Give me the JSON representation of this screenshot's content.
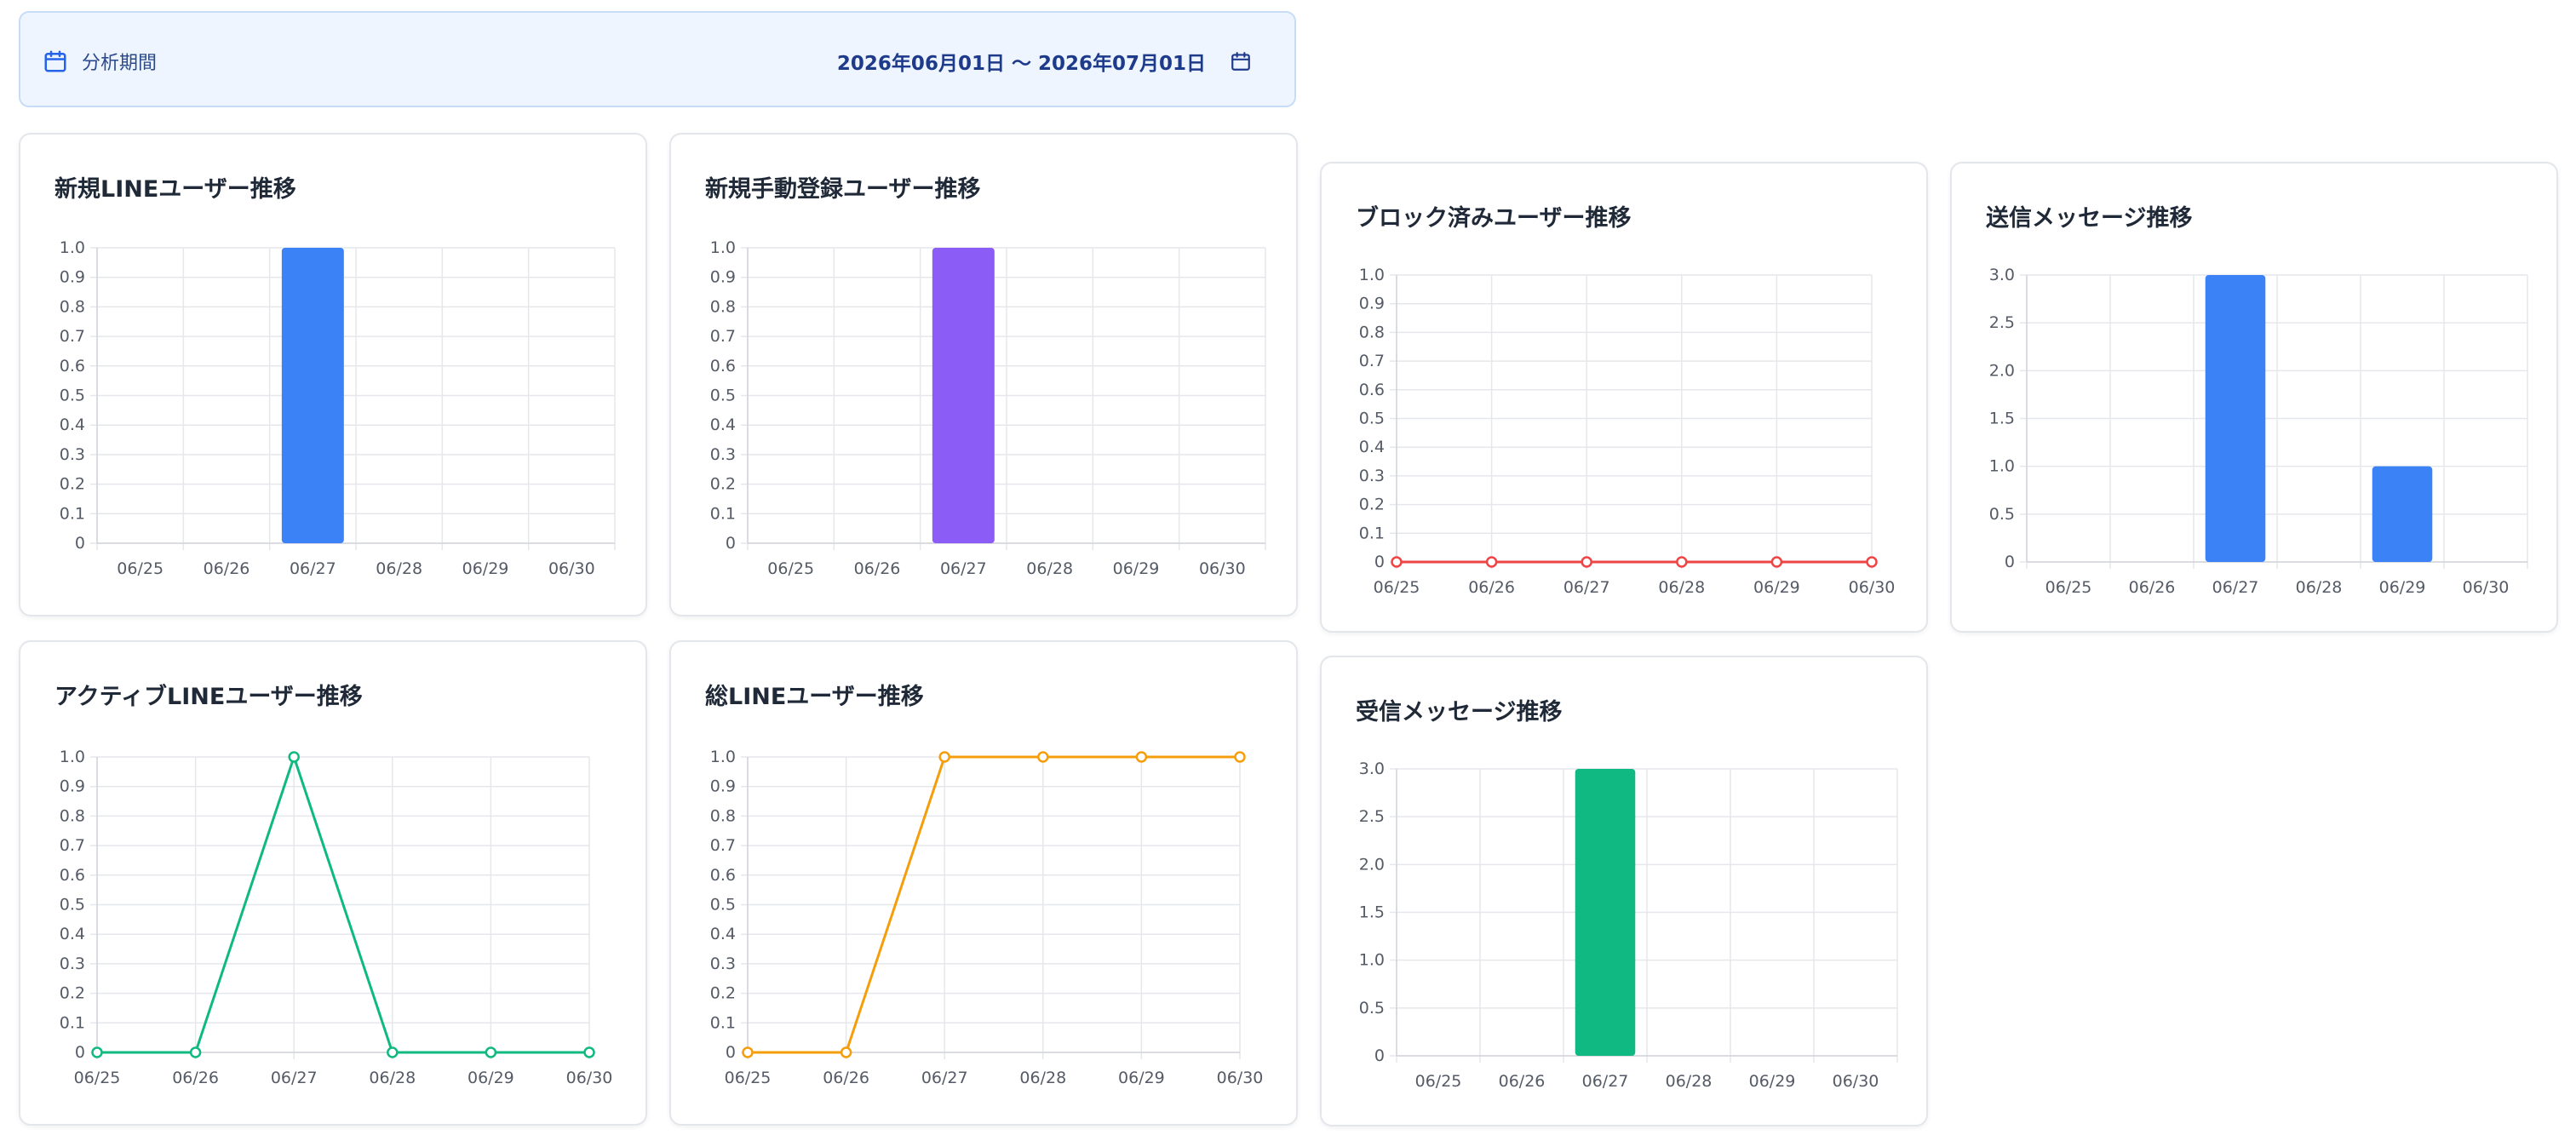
{
  "period": {
    "label": "分析期間",
    "range": "2026年06月01日 〜 2026年07月01日",
    "icon_left": "calendar-icon",
    "icon_right": "calendar-icon"
  },
  "colors": {
    "blue": "#3b82f6",
    "purple": "#8b5cf6",
    "red": "#ef4444",
    "green": "#10b981",
    "orange": "#f59e0b"
  },
  "cards": [
    {
      "title": "新規LINEユーザー推移"
    },
    {
      "title": "新規手動登録ユーザー推移"
    },
    {
      "title": "ブロック済みユーザー推移"
    },
    {
      "title": "送信メッセージ推移"
    },
    {
      "title": "アクティブLINEユーザー推移"
    },
    {
      "title": "総LINEユーザー推移"
    },
    {
      "title": "受信メッセージ推移"
    }
  ],
  "chart_data": [
    {
      "type": "bar",
      "title": "新規LINEユーザー推移",
      "categories": [
        "06/25",
        "06/26",
        "06/27",
        "06/28",
        "06/29",
        "06/30"
      ],
      "values": [
        0,
        0,
        1,
        0,
        0,
        0
      ],
      "ylim": [
        0,
        1.0
      ],
      "yticks": [
        "0",
        "0.1",
        "0.2",
        "0.3",
        "0.4",
        "0.5",
        "0.6",
        "0.7",
        "0.8",
        "0.9",
        "1.0"
      ],
      "color": "#3b82f6",
      "grid": true,
      "legend": false
    },
    {
      "type": "bar",
      "title": "新規手動登録ユーザー推移",
      "categories": [
        "06/25",
        "06/26",
        "06/27",
        "06/28",
        "06/29",
        "06/30"
      ],
      "values": [
        0,
        0,
        1,
        0,
        0,
        0
      ],
      "ylim": [
        0,
        1.0
      ],
      "yticks": [
        "0",
        "0.1",
        "0.2",
        "0.3",
        "0.4",
        "0.5",
        "0.6",
        "0.7",
        "0.8",
        "0.9",
        "1.0"
      ],
      "color": "#8b5cf6",
      "grid": true,
      "legend": false
    },
    {
      "type": "line",
      "title": "ブロック済みユーザー推移",
      "categories": [
        "06/25",
        "06/26",
        "06/27",
        "06/28",
        "06/29",
        "06/30"
      ],
      "values": [
        0,
        0,
        0,
        0,
        0,
        0
      ],
      "ylim": [
        0,
        1.0
      ],
      "yticks": [
        "0",
        "0.1",
        "0.2",
        "0.3",
        "0.4",
        "0.5",
        "0.6",
        "0.7",
        "0.8",
        "0.9",
        "1.0"
      ],
      "color": "#ef4444",
      "grid": true,
      "legend": false
    },
    {
      "type": "bar",
      "title": "送信メッセージ推移",
      "categories": [
        "06/25",
        "06/26",
        "06/27",
        "06/28",
        "06/29",
        "06/30"
      ],
      "values": [
        0,
        0,
        3,
        0,
        1,
        0
      ],
      "ylim": [
        0,
        3.0
      ],
      "yticks": [
        "0",
        "0.5",
        "1.0",
        "1.5",
        "2.0",
        "2.5",
        "3.0"
      ],
      "color": "#3b82f6",
      "grid": true,
      "legend": false
    },
    {
      "type": "line",
      "title": "アクティブLINEユーザー推移",
      "categories": [
        "06/25",
        "06/26",
        "06/27",
        "06/28",
        "06/29",
        "06/30"
      ],
      "values": [
        0,
        0,
        1,
        0,
        0,
        0
      ],
      "ylim": [
        0,
        1.0
      ],
      "yticks": [
        "0",
        "0.1",
        "0.2",
        "0.3",
        "0.4",
        "0.5",
        "0.6",
        "0.7",
        "0.8",
        "0.9",
        "1.0"
      ],
      "color": "#10b981",
      "grid": true,
      "legend": false
    },
    {
      "type": "line",
      "title": "総LINEユーザー推移",
      "categories": [
        "06/25",
        "06/26",
        "06/27",
        "06/28",
        "06/29",
        "06/30"
      ],
      "values": [
        0,
        0,
        1,
        1,
        1,
        1
      ],
      "ylim": [
        0,
        1.0
      ],
      "yticks": [
        "0",
        "0.1",
        "0.2",
        "0.3",
        "0.4",
        "0.5",
        "0.6",
        "0.7",
        "0.8",
        "0.9",
        "1.0"
      ],
      "color": "#f59e0b",
      "grid": true,
      "legend": false
    },
    {
      "type": "bar",
      "title": "受信メッセージ推移",
      "categories": [
        "06/25",
        "06/26",
        "06/27",
        "06/28",
        "06/29",
        "06/30"
      ],
      "values": [
        0,
        0,
        3,
        0,
        0,
        0
      ],
      "ylim": [
        0,
        3.0
      ],
      "yticks": [
        "0",
        "0.5",
        "1.0",
        "1.5",
        "2.0",
        "2.5",
        "3.0"
      ],
      "color": "#10b981",
      "grid": true,
      "legend": false
    }
  ]
}
